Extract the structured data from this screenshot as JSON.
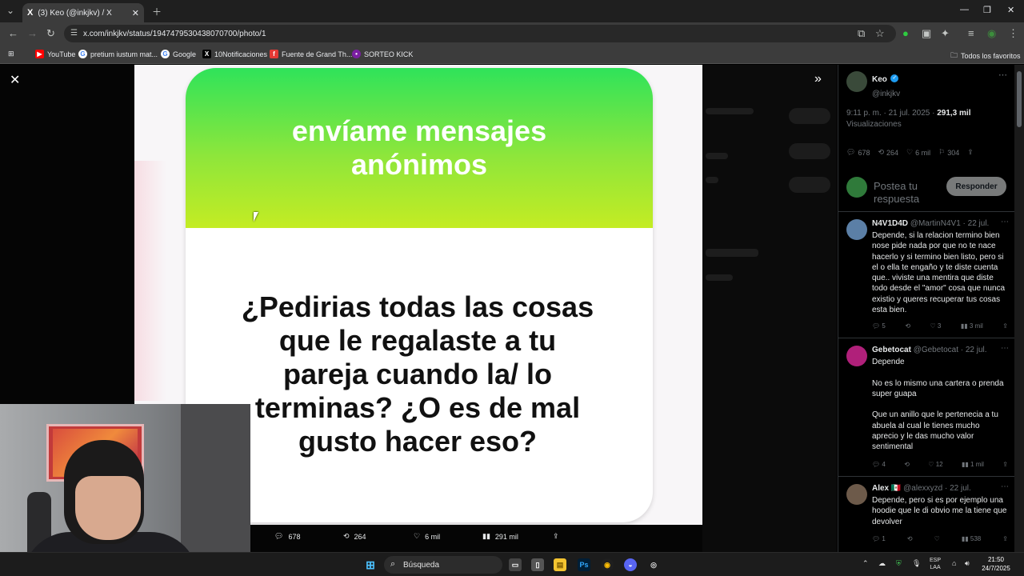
{
  "browser": {
    "tab_title": "(3) Keo (@inkjkv) / X",
    "tab_favicon": "X",
    "url": "x.com/inkjkv/status/1947479530438070700/photo/1",
    "bookmarks": [
      {
        "label": "YouTube",
        "icon": "youtube-icon",
        "color": "#ff0000"
      },
      {
        "label": "pretium iustum mat...",
        "icon": "google-icon",
        "color": "#ffffff"
      },
      {
        "label": "Google",
        "icon": "google-icon",
        "color": "#ffffff"
      },
      {
        "label": "10Notificaciones",
        "icon": "x-icon",
        "color": "#000000"
      },
      {
        "label": "Fuente de Grand Th...",
        "icon": "f-icon",
        "color": "#e53935"
      },
      {
        "label": "SORTEO KICK",
        "icon": "kick-icon",
        "color": "#7b1fa2"
      }
    ],
    "all_favorites": "Todos los favoritos"
  },
  "photo": {
    "header_text": "envíame mensajes anónimos",
    "question": "¿Pedirias todas las cosas que le regalaste a tu pareja cuando la/ lo terminas? ¿O es de mal gusto hacer eso?"
  },
  "photo_actions": {
    "replies": "678",
    "reposts": "264",
    "likes": "6 mil",
    "views": "291 mil"
  },
  "tweet": {
    "author_name": "Keo",
    "author_handle": "@inkjkv",
    "time": "9:11 p. m. · 21 jul. 2025 ·",
    "views_count": "291,3 mil",
    "views_label": "Visualizaciones",
    "stats": {
      "replies": "678",
      "reposts": "264",
      "likes": "6 mil",
      "bookmarks": "304"
    },
    "reply_placeholder": "Postea tu respuesta",
    "reply_button": "Responder"
  },
  "replies": [
    {
      "name": "N4V1D4D",
      "handle": "@MartinN4V1 · 22 jul.",
      "text": "Depende, si la relacion termino bien nose pide nada por que no te nace hacerlo y si termino bien listo, pero si el o ella te engaño y te diste cuenta que.. viviste una mentira que diste todo desde el \"amor\" cosa que nunca existio y queres recuperar tus cosas esta bien.",
      "replies": "5",
      "reposts": "",
      "likes": "3",
      "views": "3 mil",
      "avatar_color": "#5b7fa6"
    },
    {
      "name": "Gebetocat",
      "handle": "@Gebetocat · 22 jul.",
      "text": "Depende\n\nNo es lo mismo una cartera o prenda super guapa\n\nQue un anillo que le pertenecia a tu abuela al cual le tienes mucho aprecio y le das mucho valor sentimental",
      "replies": "4",
      "reposts": "",
      "likes": "12",
      "views": "1 mil",
      "avatar_color": "#b0207a"
    },
    {
      "name": "Alex 🇲🇽",
      "handle": "@alexxyzd · 22 jul.",
      "text": "Depende, pero si es por ejemplo una hoodie que le di obvio me la tiene que devolver",
      "replies": "1",
      "reposts": "",
      "likes": "",
      "views": "538",
      "avatar_color": "#6d5a4a"
    }
  ],
  "taskbar": {
    "search_label": "Búsqueda",
    "language": "ESP",
    "language_sub": "LAA",
    "time": "21:50",
    "date": "24/7/2025"
  }
}
